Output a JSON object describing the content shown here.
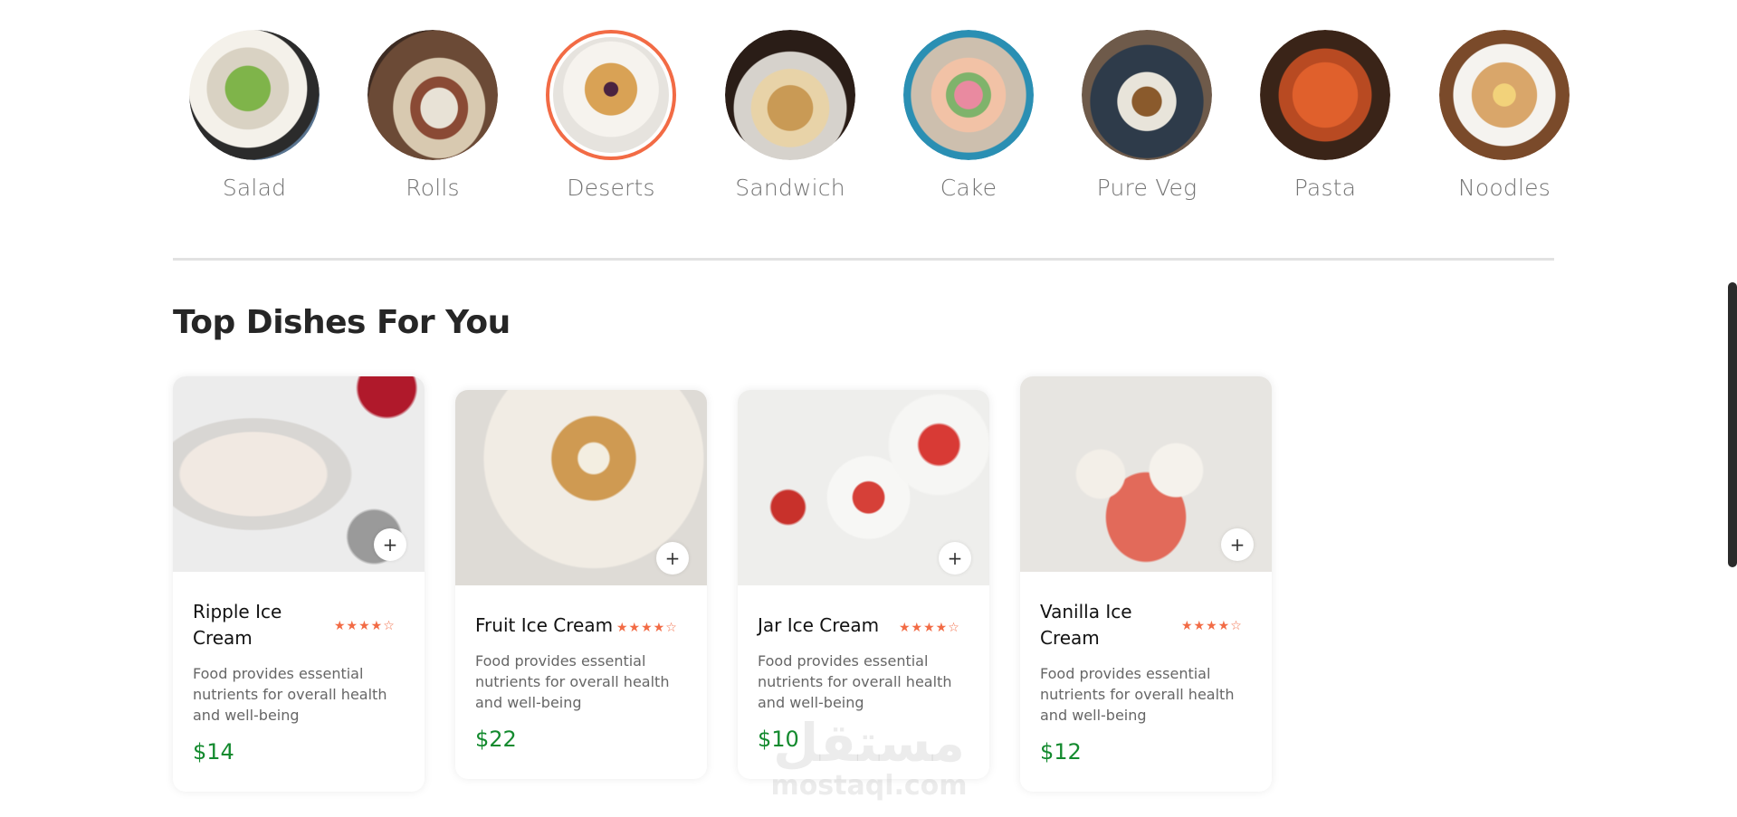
{
  "menu": {
    "items": [
      {
        "label": "Salad",
        "active": false
      },
      {
        "label": "Rolls",
        "active": false
      },
      {
        "label": "Deserts",
        "active": true
      },
      {
        "label": "Sandwich",
        "active": false
      },
      {
        "label": "Cake",
        "active": false
      },
      {
        "label": "Pure Veg",
        "active": false
      },
      {
        "label": "Pasta",
        "active": false
      },
      {
        "label": "Noodles",
        "active": false
      }
    ]
  },
  "section": {
    "title": "Top Dishes For You"
  },
  "dishes": [
    {
      "name": "Ripple Ice Cream",
      "rating": 4,
      "stars": "★★★★☆",
      "description": "Food provides essential nutrients for overall health and well-being",
      "price": "$14",
      "add_label": "+"
    },
    {
      "name": "Fruit Ice Cream",
      "rating": 4,
      "stars": "★★★★☆",
      "description": "Food provides essential nutrients for overall health and well-being",
      "price": "$22",
      "add_label": "+"
    },
    {
      "name": "Jar Ice Cream",
      "rating": 4,
      "stars": "★★★★☆",
      "description": "Food provides essential nutrients for overall health and well-being",
      "price": "$10",
      "add_label": "+"
    },
    {
      "name": "Vanilla Ice Cream",
      "rating": 4,
      "stars": "★★★★☆",
      "description": "Food provides essential nutrients for overall health and well-being",
      "price": "$12",
      "add_label": "+"
    }
  ],
  "watermark": {
    "arabic": "مستقل",
    "latin": "mostaql.com"
  },
  "colors": {
    "accent": "#f26b45",
    "price": "#138a2e",
    "divider": "#e2e2e2"
  }
}
